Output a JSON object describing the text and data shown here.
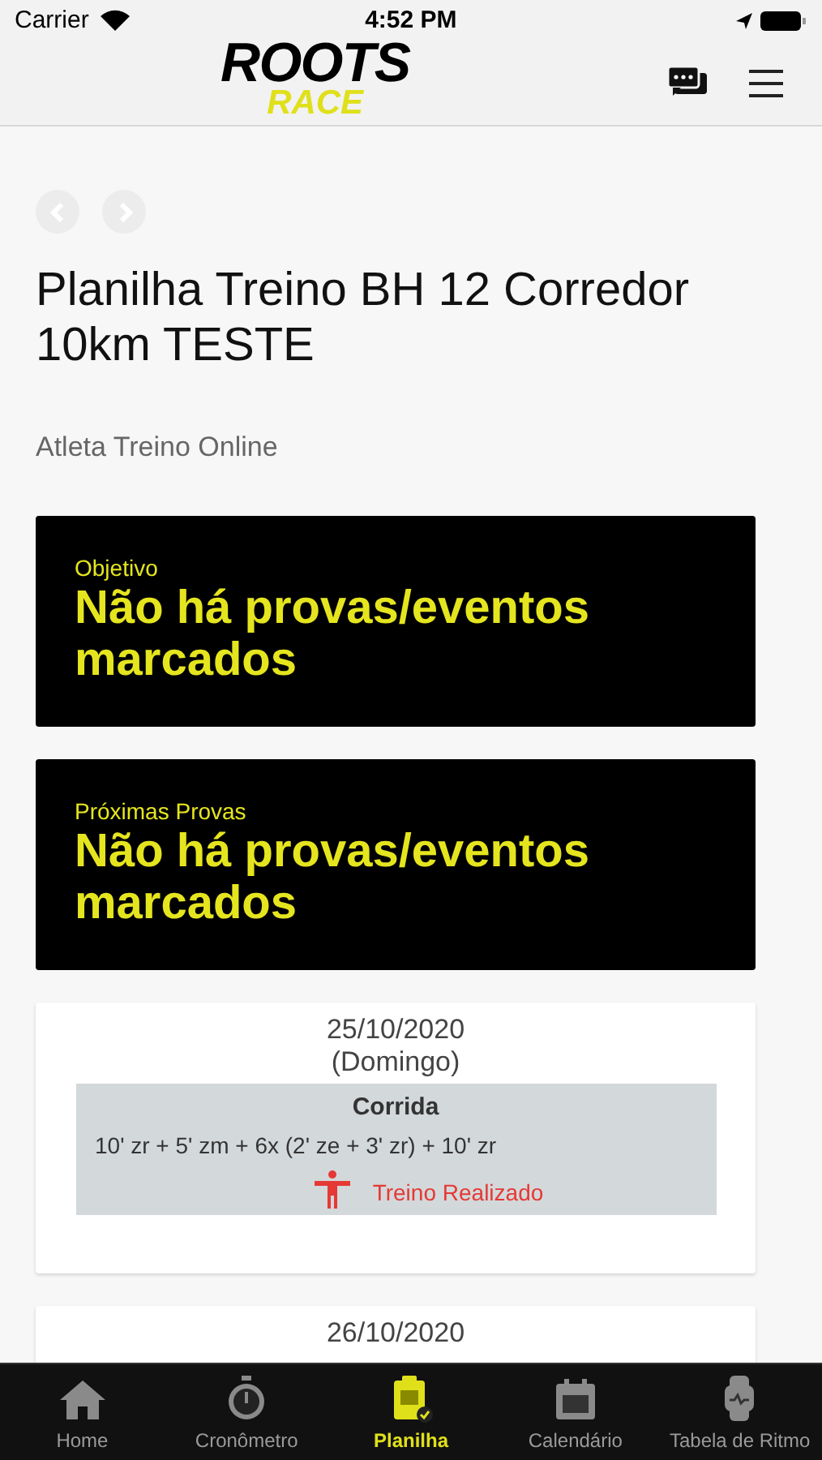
{
  "status_bar": {
    "carrier": "Carrier",
    "time": "4:52 PM"
  },
  "header": {
    "logo_top": "ROOTS",
    "logo_bottom": "RACE"
  },
  "title": "Planilha Treino BH 12 Corredor 10km TESTE",
  "subtitle": "Atleta Treino Online",
  "info_cards": [
    {
      "label": "Objetivo",
      "text": "Não há provas/eventos marcados"
    },
    {
      "label": "Próximas Provas",
      "text": "Não há provas/eventos marcados"
    }
  ],
  "days": [
    {
      "date": "25/10/2020",
      "weekday": "(Domingo)",
      "workouts": [
        {
          "type": "Corrida",
          "description": "10' zr + 5' zm + 6x (2' ze + 3' zr) + 10' zr",
          "done": true,
          "status": "Treino Realizado"
        }
      ]
    },
    {
      "date": "26/10/2020"
    }
  ],
  "tabs": [
    {
      "label": "Home",
      "selected": false
    },
    {
      "label": "Cronômetro",
      "selected": false
    },
    {
      "label": "Planilha",
      "selected": true
    },
    {
      "label": "Calendário",
      "selected": false
    },
    {
      "label": "Tabela de Ritmo",
      "selected": false
    }
  ]
}
